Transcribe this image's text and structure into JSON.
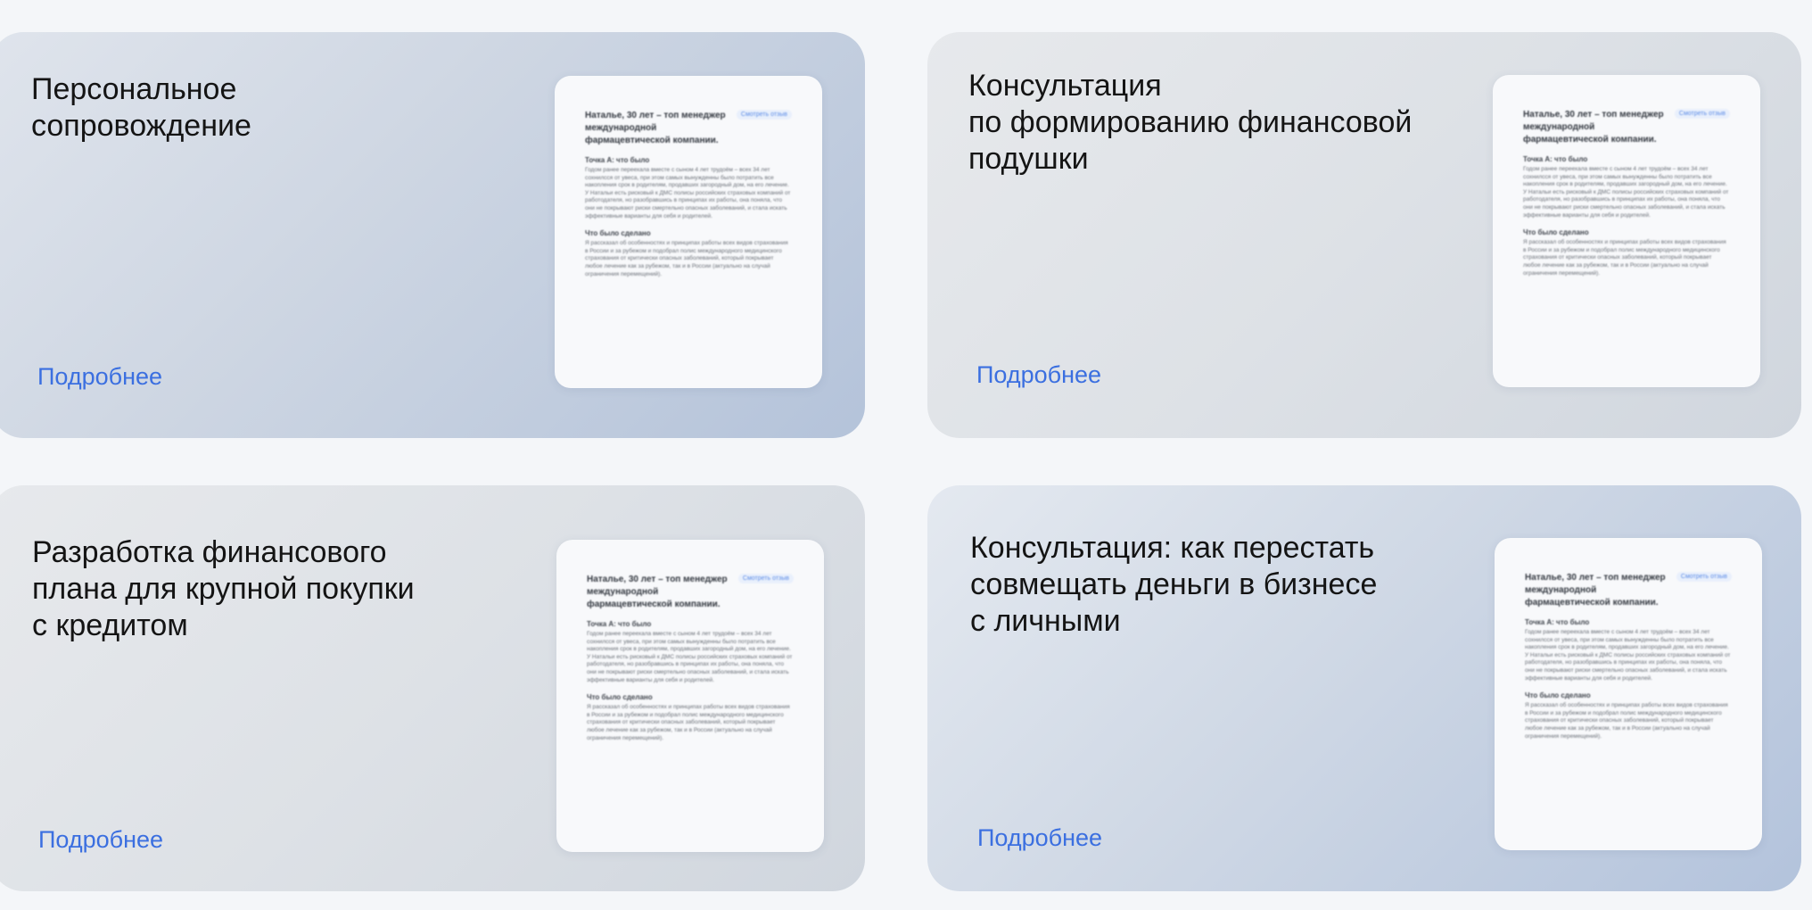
{
  "cards": [
    {
      "title": "Персональное\nсопровождение",
      "link": "Подробнее"
    },
    {
      "title": "Консультация\nпо формированию финансовой\nподушки",
      "link": "Подробнее"
    },
    {
      "title": "Разработка финансового\nплана для крупной покупки\nс кредитом",
      "link": "Подробнее"
    },
    {
      "title": "Консультация: как перестать\nсовмещать деньги в бизнесе\nс личными",
      "link": "Подробнее"
    }
  ],
  "doc_preview": {
    "heading": "Наталье, 30 лет – топ менеджер международной фармацевтической компании.",
    "badge": "Смотреть отзыв",
    "section_a_title": "Точка А: что было",
    "section_a_text": "Годом ранее переехала вместе с сыном 4 лет трудоём – всех 34 лет сохнилсся от увеса, при этом самых вынужденны было потратить все накопления срок в родителям, продавших загородный дом, на его лечение. У Натальи есть рисковый к ДМС полисы российских страховых компаний от работодателя, но разобравшись в принципах их работы, она поняла, что они не покрывают риски смертельно опасных заболеваний, и стала искать эффективные варианты для себя и родителей.",
    "section_b_title": "Что было сделано",
    "section_b_text": "Я рассказал об особенностях и принципах работы всех видов страхования в России и за рубежом и подобрал полис международного медицинского страхования от критически опасных заболеваний, который покрывает любое лечение как за рубежом, так и в России (актуально на случай ограничения перемещений)."
  },
  "colors": {
    "page_background": "#f4f6f9",
    "link": "#3b6fe0",
    "title": "#141414"
  }
}
